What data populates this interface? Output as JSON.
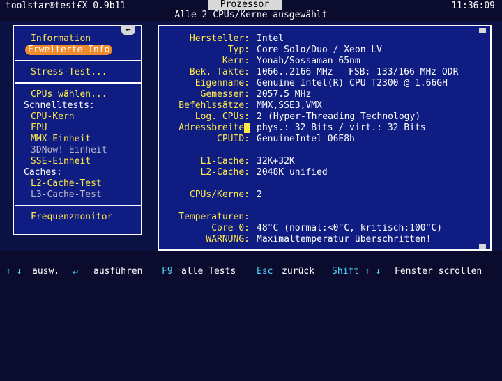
{
  "header": {
    "app_title": "toolstar®test£X 0.9b11",
    "window_tab": "Prozessor",
    "clock": "11:36:09",
    "subtitle": "Alle 2 CPUs/Kerne ausgewählt"
  },
  "sidebar": {
    "scroll_button": "←",
    "items": [
      {
        "label": "Information",
        "style": "yellow"
      },
      {
        "label": "Erweiterte Info",
        "style": "selected"
      },
      {
        "label": "Stress-Test...",
        "style": "yellow"
      },
      {
        "label": "CPUs wählen...",
        "style": "yellow"
      },
      {
        "label": "Schnelltests:",
        "style": "white"
      },
      {
        "label": "CPU-Kern",
        "style": "yellow"
      },
      {
        "label": "FPU",
        "style": "yellow"
      },
      {
        "label": "MMX-Einheit",
        "style": "yellow"
      },
      {
        "label": "3DNow!-Einheit",
        "style": "disabled"
      },
      {
        "label": "SSE-Einheit",
        "style": "yellow"
      },
      {
        "label": "Caches:",
        "style": "white"
      },
      {
        "label": "L2-Cache-Test",
        "style": "yellow"
      },
      {
        "label": "L3-Cache-Test",
        "style": "disabled"
      },
      {
        "label": "Frequenzmonitor",
        "style": "yellow"
      }
    ]
  },
  "info": {
    "rows": [
      {
        "label": "Hersteller:",
        "value": "Intel"
      },
      {
        "label": "Typ:",
        "value": "Core Solo/Duo / Xeon LV"
      },
      {
        "label": "Kern:",
        "value": "Yonah/Sossaman 65nm"
      },
      {
        "label": "Bek. Takte:",
        "value": "1066..2166 MHz",
        "extra_label": "FSB:",
        "extra_value": "133/166 MHz QDR"
      },
      {
        "label": "Eigenname:",
        "value": "Genuine Intel(R) CPU T2300 @ 1.66GH"
      },
      {
        "label": "Gemessen:",
        "value": "2057.5 MHz"
      },
      {
        "label": "Befehlssätze:",
        "value": "MMX,SSE3,VMX"
      },
      {
        "label": "Log. CPUs:",
        "value": "2",
        "value2": "(Hyper-Threading Technology)"
      },
      {
        "label": "Adressbreite:",
        "value": "phys.: 32 Bits / virt.: 32 Bits"
      },
      {
        "label": "CPUID:",
        "value": "GenuineIntel 06E8h"
      },
      {
        "label": "L1-Cache:",
        "value": "32K+32K"
      },
      {
        "label": "L2-Cache:",
        "value": "2048K unified"
      },
      {
        "label": "CPUs/Kerne:",
        "value": "2"
      },
      {
        "label": "Temperaturen:",
        "value": ""
      },
      {
        "label": "Core 0:",
        "value": "48°C (normal:<0°C, kritisch:100°C)"
      },
      {
        "label": "WARNUNG:",
        "value": "Maximaltemperatur überschritten!"
      }
    ]
  },
  "footer": {
    "nav_keys": "↑ ↓",
    "nav_label": "ausw.",
    "enter_key": "↵",
    "enter_label": "ausführen",
    "f9_key": "F9",
    "f9_label": "alle Tests",
    "esc_key": "Esc",
    "esc_label": "zurück",
    "shift_key": "Shift ↑ ↓",
    "shift_label": "Fenster scrollen"
  },
  "colors": {
    "panel_bg": "#0f1d82",
    "label_yellow": "#ffe84a",
    "selected_orange": "#f08a2a",
    "warning_orange": "#ff9c3a",
    "key_cyan": "#4ad8ff"
  }
}
